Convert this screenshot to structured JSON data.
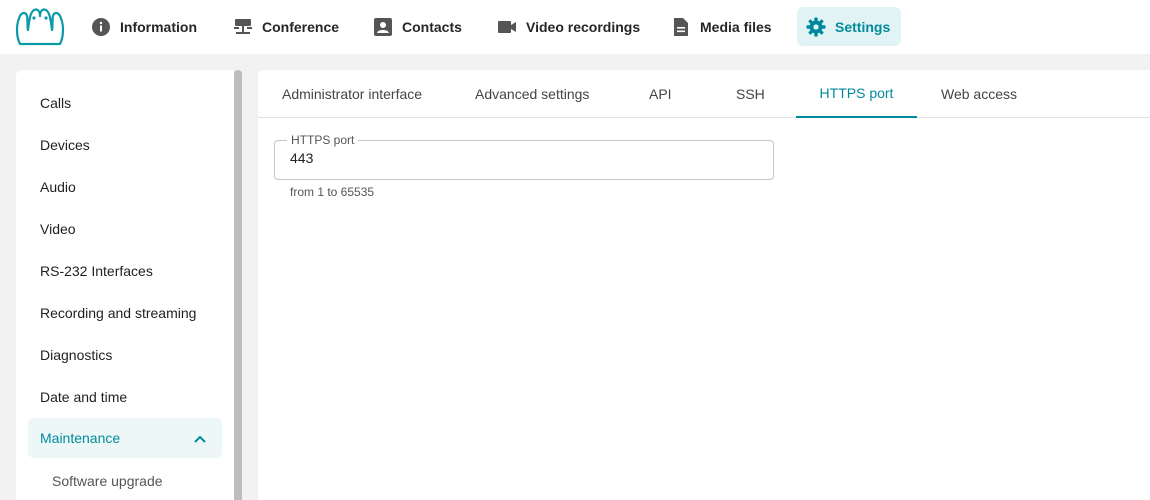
{
  "topnav": {
    "items": [
      {
        "label": "Information",
        "icon": "info-icon"
      },
      {
        "label": "Conference",
        "icon": "conference-icon"
      },
      {
        "label": "Contacts",
        "icon": "contacts-icon"
      },
      {
        "label": "Video recordings",
        "icon": "video-camera-icon"
      },
      {
        "label": "Media files",
        "icon": "document-icon"
      },
      {
        "label": "Settings",
        "icon": "gear-icon",
        "active": true
      }
    ]
  },
  "sidebar": {
    "items": [
      {
        "label": "Calls"
      },
      {
        "label": "Devices"
      },
      {
        "label": "Audio"
      },
      {
        "label": "Video"
      },
      {
        "label": "RS-232 Interfaces"
      },
      {
        "label": "Recording and streaming"
      },
      {
        "label": "Diagnostics"
      },
      {
        "label": "Date and time"
      }
    ],
    "group": {
      "label": "Maintenance",
      "expanded": true
    },
    "sub_items": [
      {
        "label": "Software upgrade"
      }
    ]
  },
  "tabs": [
    {
      "label": "Administrator interface"
    },
    {
      "label": "Advanced settings"
    },
    {
      "label": "API"
    },
    {
      "label": "SSH"
    },
    {
      "label": "HTTPS port",
      "active": true
    },
    {
      "label": "Web access"
    }
  ],
  "form": {
    "https_port": {
      "label": "HTTPS port",
      "value": "443",
      "hint": "from 1 to 65535"
    }
  },
  "colors": {
    "accent": "#008b9c",
    "accent_bg": "#e1f3f5",
    "background": "#f2f2f2"
  }
}
